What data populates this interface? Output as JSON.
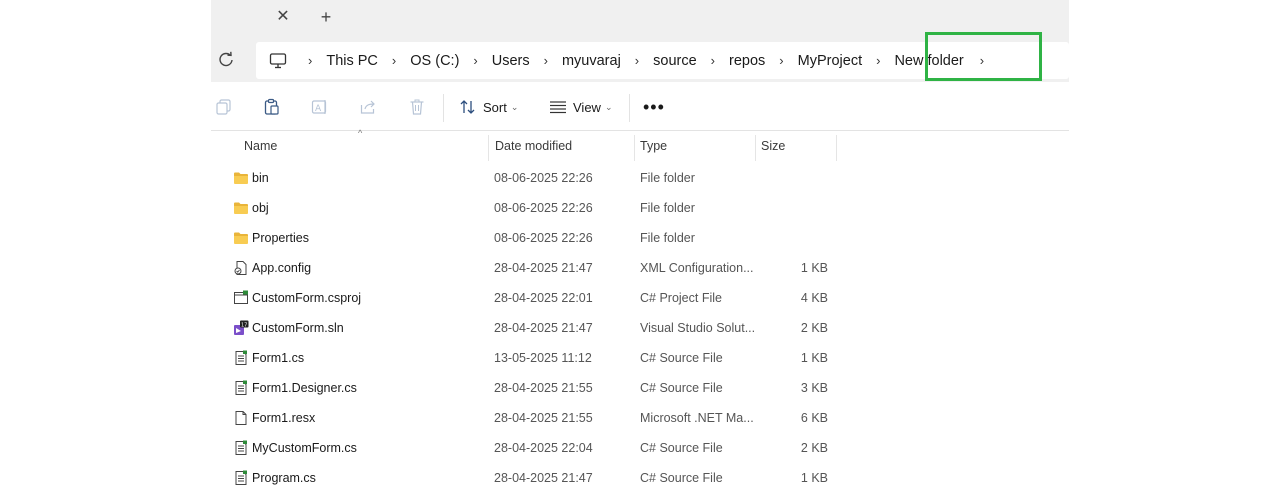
{
  "tabstrip": {
    "close_glyph": "✕",
    "new_tab_glyph": "+"
  },
  "address": {
    "crumbs": [
      "This PC",
      "OS (C:)",
      "Users",
      "myuvaraj",
      "source",
      "repos",
      "MyProject",
      "New folder"
    ],
    "separator": "›",
    "highlight_color": "#2fb345"
  },
  "toolbar": {
    "sort_label": "Sort",
    "view_label": "View",
    "more_glyph": "•••",
    "icons": [
      "copy-icon",
      "paste-icon",
      "rename-icon",
      "share-icon",
      "delete-icon"
    ]
  },
  "columns": {
    "name": "Name",
    "date": "Date modified",
    "type": "Type",
    "size": "Size",
    "sort_caret": "^"
  },
  "files": [
    {
      "name": "bin",
      "date": "08-06-2025 22:26",
      "type": "File folder",
      "size": "",
      "icon": "folder-icon"
    },
    {
      "name": "obj",
      "date": "08-06-2025 22:26",
      "type": "File folder",
      "size": "",
      "icon": "folder-icon"
    },
    {
      "name": "Properties",
      "date": "08-06-2025 22:26",
      "type": "File folder",
      "size": "",
      "icon": "folder-icon"
    },
    {
      "name": "App.config",
      "date": "28-04-2025 21:47",
      "type": "XML Configuration...",
      "size": "1 KB",
      "icon": "config-file-icon"
    },
    {
      "name": "CustomForm.csproj",
      "date": "28-04-2025 22:01",
      "type": "C# Project File",
      "size": "4 KB",
      "icon": "csproj-file-icon"
    },
    {
      "name": "CustomForm.sln",
      "date": "28-04-2025 21:47",
      "type": "Visual Studio Solut...",
      "size": "2 KB",
      "icon": "sln-file-icon"
    },
    {
      "name": "Form1.cs",
      "date": "13-05-2025 11:12",
      "type": "C# Source File",
      "size": "1 KB",
      "icon": "cs-file-icon"
    },
    {
      "name": "Form1.Designer.cs",
      "date": "28-04-2025 21:55",
      "type": "C# Source File",
      "size": "3 KB",
      "icon": "cs-file-icon"
    },
    {
      "name": "Form1.resx",
      "date": "28-04-2025 21:55",
      "type": "Microsoft .NET Ma...",
      "size": "6 KB",
      "icon": "resx-file-icon"
    },
    {
      "name": "MyCustomForm.cs",
      "date": "28-04-2025 22:04",
      "type": "C# Source File",
      "size": "2 KB",
      "icon": "cs-file-icon"
    },
    {
      "name": "Program.cs",
      "date": "28-04-2025 21:47",
      "type": "C# Source File",
      "size": "1 KB",
      "icon": "cs-file-icon"
    }
  ]
}
